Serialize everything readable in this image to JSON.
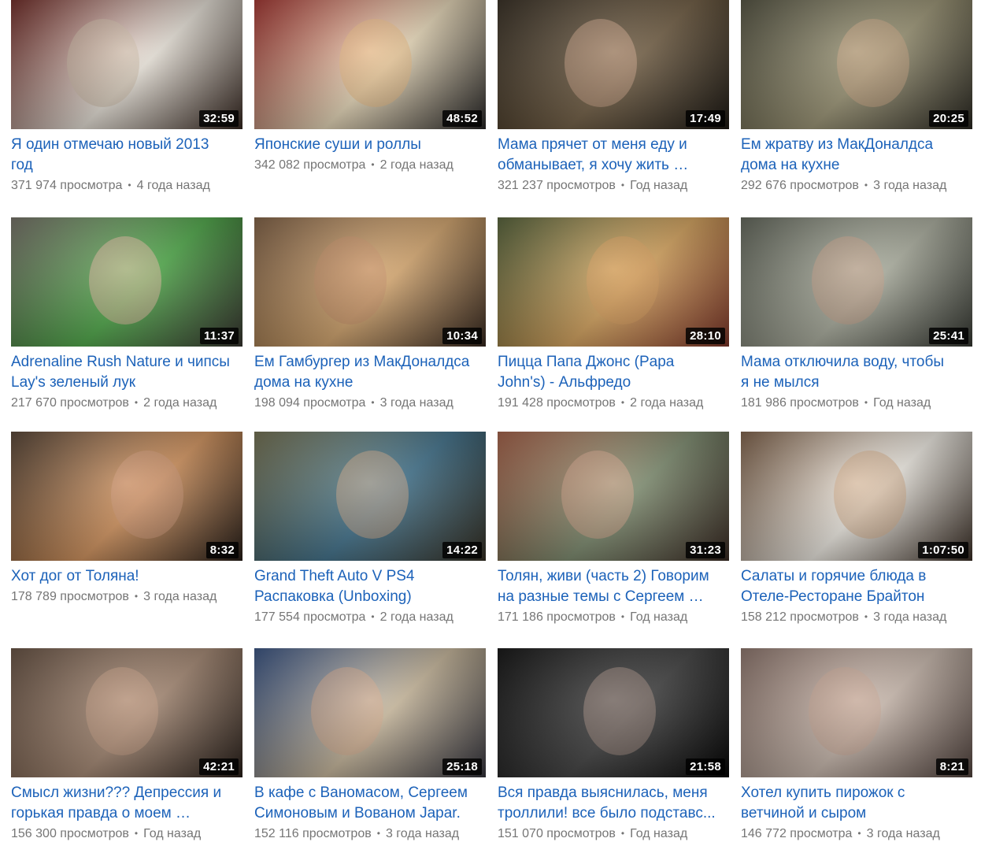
{
  "videos": [
    {
      "title_lines": [
        "Я один отмечаю новый 2013",
        "год"
      ],
      "duration": "32:59",
      "views": "371 974 просмотра",
      "age": "4 года назад",
      "thumb": [
        "#7a2f2a",
        "#e8e2d8",
        "#3a2a22"
      ],
      "skin": "#c9b7a0"
    },
    {
      "title_lines": [
        "Японские суши и роллы"
      ],
      "duration": "48:52",
      "views": "342 082 просмотра",
      "age": "2 года назад",
      "thumb": [
        "#b23a35",
        "#e9d9b8",
        "#2b2a2a"
      ],
      "skin": "#e8b67a"
    },
    {
      "title_lines": [
        "Мама прячет от меня еду и",
        "обманывает, я хочу жить"
      ],
      "truncated": [
        false,
        true
      ],
      "duration": "17:49",
      "views": "321 237 просмотров",
      "age": "Год назад",
      "thumb": [
        "#3b3226",
        "#6e5a3f",
        "#1e1a14"
      ],
      "skin": "#c79d80"
    },
    {
      "title_lines": [
        "Ем жратву из МакДоналдса",
        "дома на кухне"
      ],
      "duration": "20:25",
      "views": "292 676 просмотров",
      "age": "3 года назад",
      "thumb": [
        "#5b5a47",
        "#9a9372",
        "#2e2c24"
      ],
      "skin": "#c8a27e"
    },
    {
      "title_lines": [
        "Adrenaline Rush Nature и чипсы",
        "Lay's зеленый лук"
      ],
      "duration": "11:37",
      "views": "217 670 просмотров",
      "age": "2 года назад",
      "thumb": [
        "#7f7a70",
        "#4aa844",
        "#3e3a35"
      ],
      "skin": "#e1b89c"
    },
    {
      "title_lines": [
        "Ем Гамбургер из МакДоналдса",
        "дома на кухне"
      ],
      "duration": "10:34",
      "views": "198 094 просмотра",
      "age": "3 года назад",
      "thumb": [
        "#8c6a4c",
        "#d4a46a",
        "#3c2c22"
      ],
      "skin": "#c48a60"
    },
    {
      "title_lines": [
        "Пицца Папа Джонс (Papa",
        "John's) - Альфредо"
      ],
      "duration": "28:10",
      "views": "191 428 просмотров",
      "age": "2 года назад",
      "thumb": [
        "#5d6b3f",
        "#d7a35a",
        "#8a3a2c"
      ],
      "skin": "#d99a55"
    },
    {
      "title_lines": [
        "Мама отключила воду, чтобы",
        "я не мылся"
      ],
      "duration": "25:41",
      "views": "181 986 просмотров",
      "age": "Год назад",
      "thumb": [
        "#6a6f62",
        "#a9ac9c",
        "#3a3d36"
      ],
      "skin": "#c69f85"
    },
    {
      "title_lines": [
        "Хот дог от Толяна!"
      ],
      "duration": "8:32",
      "views": "178 789 просмотров",
      "age": "3 года назад",
      "thumb": [
        "#5e4a3a",
        "#d4925a",
        "#2a201a"
      ],
      "skin": "#d09572"
    },
    {
      "title_lines": [
        "Grand Theft Auto V PS4",
        "Распаковка (Unboxing)"
      ],
      "duration": "14:22",
      "views": "177 554 просмотра",
      "age": "2 года назад",
      "thumb": [
        "#7d7a58",
        "#3c6f8a",
        "#3a3426"
      ],
      "skin": "#c7a283"
    },
    {
      "title_lines": [
        "Толян, живи (часть 2) Говорим",
        "на разные темы с Сергеем"
      ],
      "truncated": [
        false,
        true
      ],
      "duration": "31:23",
      "views": "171 186 просмотров",
      "age": "Год назад",
      "thumb": [
        "#b3694e",
        "#7b8a6c",
        "#3f2e26"
      ],
      "skin": "#d4a286"
    },
    {
      "title_lines": [
        "Салаты и горячие блюда в",
        "Отеле-Ресторане Брайтон"
      ],
      "duration": "1:07:50",
      "views": "158 212 просмотров",
      "age": "3 года назад",
      "thumb": [
        "#8a6a50",
        "#f0ece4",
        "#3f3228"
      ],
      "skin": "#d0a67f"
    },
    {
      "title_lines": [
        "Смысл жизни??? Депрессия и",
        "горькая правда о моем"
      ],
      "truncated": [
        false,
        true
      ],
      "duration": "42:21",
      "views": "156 300 просмотров",
      "age": "Год назад",
      "thumb": [
        "#6f5848",
        "#a48670",
        "#2c221c"
      ],
      "skin": "#c59a80"
    },
    {
      "title_lines": [
        "В кафе с Ваномасом, Сергеем",
        "Симоновым и Вованом Japar."
      ],
      "duration": "25:18",
      "views": "152 116 просмотров",
      "age": "3 года назад",
      "thumb": [
        "#3d5a8e",
        "#c8b79a",
        "#3a3a44"
      ],
      "skin": "#d6a889"
    },
    {
      "title_lines": [
        "Вся правда выяснилась, меня",
        "троллили! все было подставс..."
      ],
      "duration": "21:58",
      "views": "151 070 просмотров",
      "age": "Год назад",
      "thumb": [
        "#151515",
        "#3c3c3c",
        "#050505"
      ],
      "skin": "#9a8478"
    },
    {
      "title_lines": [
        "Хотел купить пирожок с",
        "ветчиной и сыром"
      ],
      "duration": "8:21",
      "views": "146 772 просмотра",
      "age": "3 года назад",
      "thumb": [
        "#9a8076",
        "#c9b8ac",
        "#5a4a44"
      ],
      "skin": "#c9a48f"
    }
  ]
}
